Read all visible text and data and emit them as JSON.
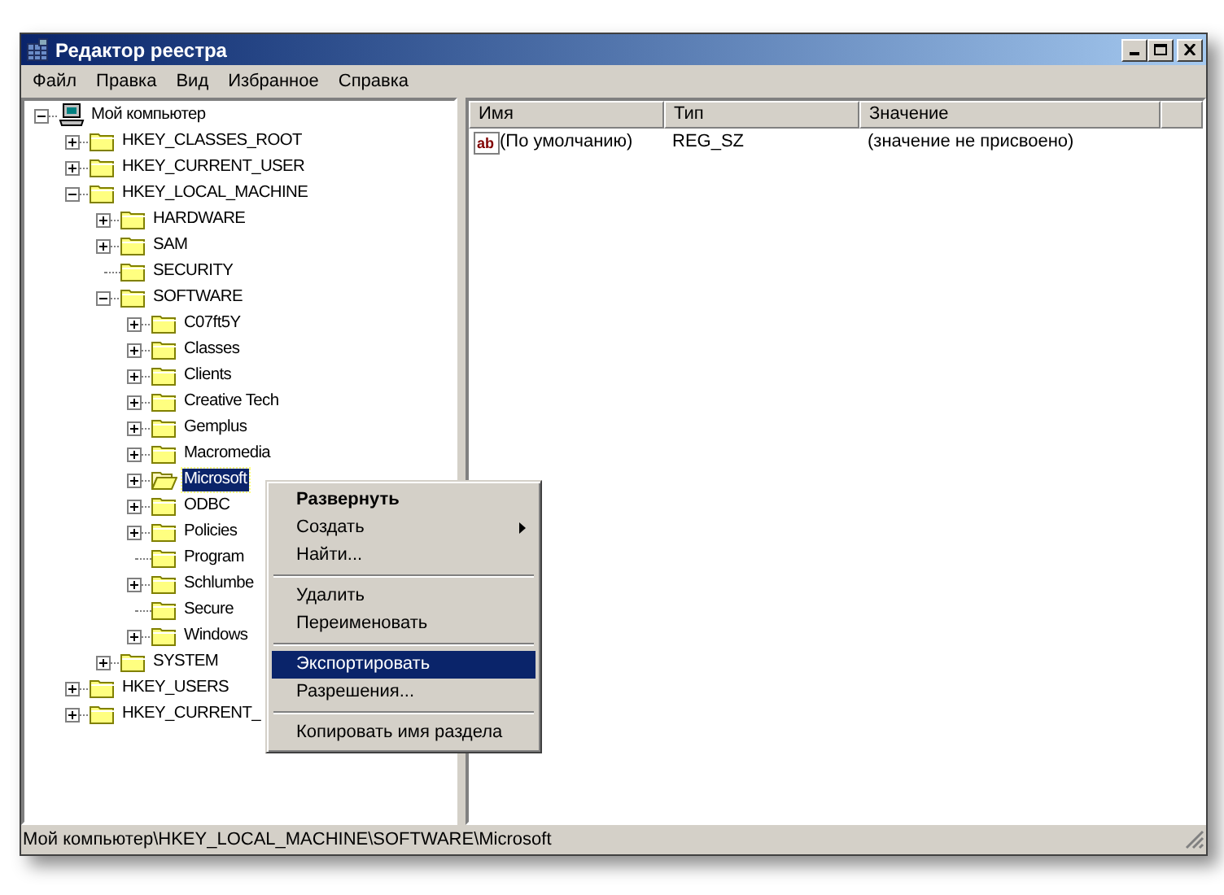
{
  "window": {
    "title": "Редактор реестра"
  },
  "menu_bar": [
    "Файл",
    "Правка",
    "Вид",
    "Избранное",
    "Справка"
  ],
  "tree": [
    {
      "label": "Мой компьютер",
      "kind": "computer",
      "expanded": true,
      "selected": false,
      "children": [
        {
          "label": "HKEY_CLASSES_ROOT",
          "kind": "folder",
          "expanded": false,
          "selected": false
        },
        {
          "label": "HKEY_CURRENT_USER",
          "kind": "folder",
          "expanded": false,
          "selected": false
        },
        {
          "label": "HKEY_LOCAL_MACHINE",
          "kind": "folder",
          "expanded": true,
          "selected": false,
          "children": [
            {
              "label": "HARDWARE",
              "kind": "folder",
              "expanded": false,
              "selected": false
            },
            {
              "label": "SAM",
              "kind": "folder",
              "expanded": false,
              "selected": false
            },
            {
              "label": "SECURITY",
              "kind": "folder",
              "selected": false
            },
            {
              "label": "SOFTWARE",
              "kind": "folder",
              "expanded": true,
              "selected": false,
              "children": [
                {
                  "label": "C07ft5Y",
                  "kind": "folder",
                  "expanded": false,
                  "selected": false
                },
                {
                  "label": "Classes",
                  "kind": "folder",
                  "expanded": false,
                  "selected": false
                },
                {
                  "label": "Clients",
                  "kind": "folder",
                  "expanded": false,
                  "selected": false
                },
                {
                  "label": "Creative Tech",
                  "kind": "folder",
                  "expanded": false,
                  "selected": false
                },
                {
                  "label": "Gemplus",
                  "kind": "folder",
                  "expanded": false,
                  "selected": false
                },
                {
                  "label": "Macromedia",
                  "kind": "folder",
                  "expanded": false,
                  "selected": false
                },
                {
                  "label": "Microsoft",
                  "kind": "folder",
                  "expanded": false,
                  "selected": true
                },
                {
                  "label": "ODBC",
                  "kind": "folder",
                  "expanded": false,
                  "selected": false
                },
                {
                  "label": "Policies",
                  "kind": "folder",
                  "expanded": false,
                  "selected": false
                },
                {
                  "label": "Program",
                  "kind": "folder",
                  "selected": false
                },
                {
                  "label": "Schlumbe",
                  "kind": "folder",
                  "expanded": false,
                  "selected": false
                },
                {
                  "label": "Secure",
                  "kind": "folder",
                  "selected": false
                },
                {
                  "label": "Windows",
                  "kind": "folder",
                  "expanded": false,
                  "selected": false
                }
              ]
            },
            {
              "label": "SYSTEM",
              "kind": "folder",
              "expanded": false,
              "selected": false
            }
          ]
        },
        {
          "label": "HKEY_USERS",
          "kind": "folder",
          "expanded": false,
          "selected": false
        },
        {
          "label": "HKEY_CURRENT_",
          "kind": "folder",
          "expanded": false,
          "selected": false
        }
      ]
    }
  ],
  "table": {
    "columns": [
      "Имя",
      "Тип",
      "Значение"
    ],
    "rows": [
      {
        "icon_label": "ab",
        "name": "(По умолчанию)",
        "type": "REG_SZ",
        "value": "(значение не присвоено)"
      }
    ]
  },
  "context_menu": [
    {
      "kind": "item",
      "label": "Развернуть",
      "default": true,
      "submenu": false,
      "selected": false
    },
    {
      "kind": "item",
      "label": "Создать",
      "default": false,
      "submenu": true,
      "selected": false
    },
    {
      "kind": "item",
      "label": "Найти...",
      "default": false,
      "submenu": false,
      "selected": false
    },
    {
      "kind": "separator"
    },
    {
      "kind": "item",
      "label": "Удалить",
      "default": false,
      "submenu": false,
      "selected": false
    },
    {
      "kind": "item",
      "label": "Переименовать",
      "default": false,
      "submenu": false,
      "selected": false
    },
    {
      "kind": "separator"
    },
    {
      "kind": "item",
      "label": "Экспортировать",
      "default": false,
      "submenu": false,
      "selected": true
    },
    {
      "kind": "item",
      "label": "Разрешения...",
      "default": false,
      "submenu": false,
      "selected": false
    },
    {
      "kind": "separator"
    },
    {
      "kind": "item",
      "label": "Копировать имя раздела",
      "default": false,
      "submenu": false,
      "selected": false
    }
  ],
  "status_bar": "Мой компьютер\\HKEY_LOCAL_MACHINE\\SOFTWARE\\Microsoft"
}
